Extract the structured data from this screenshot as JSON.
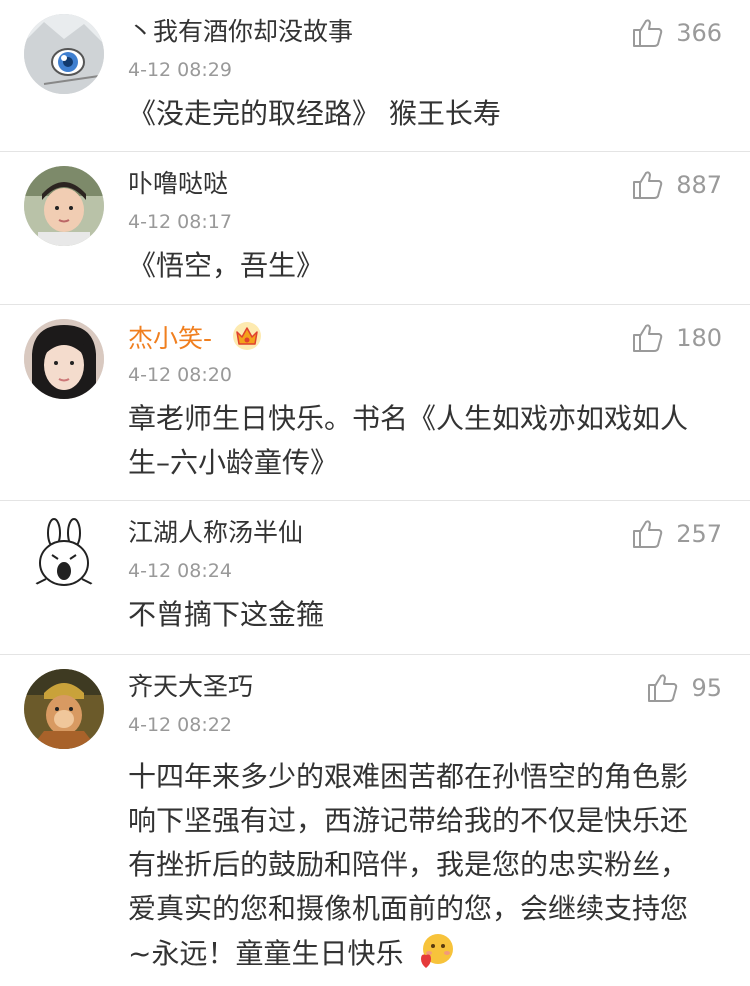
{
  "comments": [
    {
      "username": "丶我有酒你却没故事",
      "timestamp": "4-12 08:29",
      "likes": "366",
      "content": "《没走完的取经路》 猴王长寿",
      "avatar": "anime-boy-blue-eyes"
    },
    {
      "username": "卟噜哒哒",
      "timestamp": "4-12 08:17",
      "likes": "887",
      "content": "《悟空，吾生》",
      "avatar": "young-man-photo"
    },
    {
      "username": "杰小笑-",
      "timestamp": "4-12 08:20",
      "likes": "180",
      "content": "章老师生日快乐。书名《人生如戏亦如戏如人生–六小龄童传》",
      "avatar": "girl-photo",
      "badge": "vip-crown-icon"
    },
    {
      "username": "江湖人称汤半仙",
      "timestamp": "4-12 08:24",
      "likes": "257",
      "content": "不曾摘下这金箍",
      "avatar": "cartoon-rabbit"
    },
    {
      "username": "齐天大圣巧",
      "timestamp": "4-12 08:22",
      "likes": "95",
      "content": "十四年来多少的艰难困苦都在孙悟空的角色影响下坚强有过，西游记带给我的不仅是快乐还有挫折后的鼓励和陪伴，我是您的忠实粉丝，爱真实的您和摄像机面前的您，会继续支持您~永远！童童生日快乐",
      "avatar": "monkey-king-photo",
      "trailing_emoji": "heart-emoji"
    }
  ],
  "colors": {
    "vip_name": "#f07f1f",
    "meta": "#999999",
    "text": "#333333",
    "divider": "#e4e4e4"
  }
}
